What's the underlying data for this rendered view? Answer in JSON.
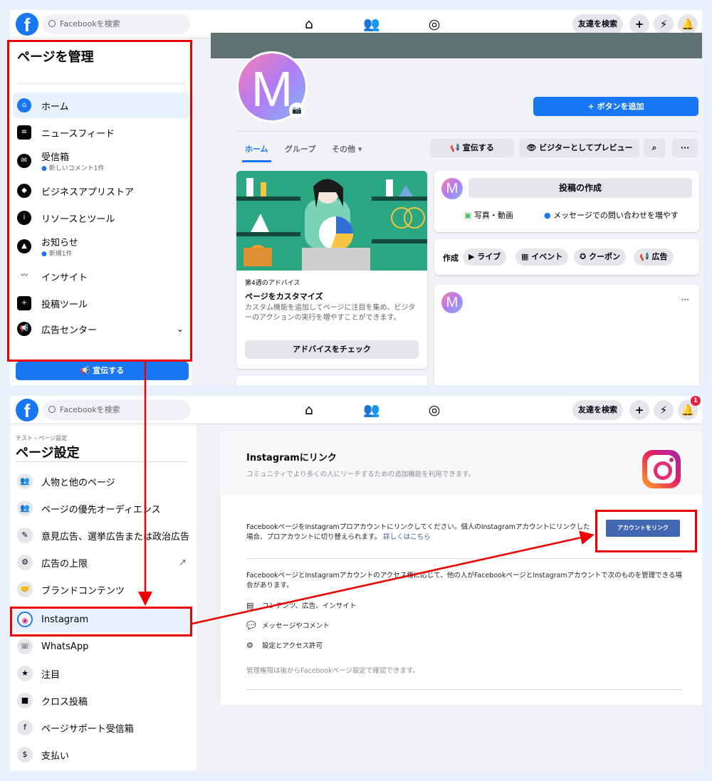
{
  "topbar": {
    "search_placeholder": "Facebookを検索",
    "find_friends": "友達を検索",
    "plus": "+",
    "notif_count": "1"
  },
  "top": {
    "sidebar": {
      "title": "ページを管理",
      "items": [
        {
          "label": "ホーム",
          "sub": ""
        },
        {
          "label": "ニュースフィード",
          "sub": ""
        },
        {
          "label": "受信箱",
          "sub": "新しいコメント1件"
        },
        {
          "label": "ビジネスアプリストア",
          "sub": ""
        },
        {
          "label": "リソースとツール",
          "sub": ""
        },
        {
          "label": "お知らせ",
          "sub": "新規1件"
        },
        {
          "label": "インサイト",
          "sub": ""
        },
        {
          "label": "投稿ツール",
          "sub": ""
        },
        {
          "label": "広告センター",
          "sub": ""
        }
      ],
      "promote": "宣伝する"
    },
    "page": {
      "avatar_letter": "M",
      "add_button": "+ ボタンを追加",
      "tabs": [
        "ホーム",
        "グループ",
        "その他 ▾"
      ],
      "promote": "宣伝する",
      "preview": "ビジターとしてプレビュー"
    },
    "advice": {
      "week": "第4週のアドバイス",
      "title": "ページをカスタマイズ",
      "body": "カスタム機能を追加してページに注目を集め、ビジターのアクションの実行を増やすことができます。",
      "button": "アドバイスをチェック"
    },
    "composer": {
      "create_post": "投稿の作成",
      "photo": "写真・動画",
      "messages": "メッセージでの問い合わせを増やす",
      "create": "作成",
      "live": "ライブ",
      "event": "イベント",
      "coupon": "クーポン",
      "ad": "広告"
    }
  },
  "bottom": {
    "sidebar": {
      "breadcrumb": "テスト › ページ設定",
      "title": "ページ設定",
      "items": [
        "人物と他のページ",
        "ページの優先オーディエンス",
        "意見広告、選挙広告または政治広告",
        "広告の上限",
        "ブランドコンテンツ",
        "Instagram",
        "WhatsApp",
        "注目",
        "クロス投稿",
        "ページサポート受信箱",
        "支払い"
      ]
    },
    "instagram": {
      "title": "Instagramにリンク",
      "subtitle": "コミュニティでより多くの人にリーチするための追加機能を利用できます。",
      "desc": "FacebookページをInstagramプロアカウントにリンクしてください。個人のInstagramアカウントにリンクした場合、プロアカウントに切り替えられます。",
      "learn_more": "詳しくはこちら",
      "link_button": "アカウントをリンク",
      "access_text": "FacebookページとInstagramアカウントのアクセス権に応じて、他の人がFacebookページとInstagramアカウントで次のものを管理できる場合があります。",
      "rows": [
        "コンテンツ、広告、インサイト",
        "メッセージやコメント",
        "設定とアクセス許可"
      ],
      "footer": "管理権限は後からFacebookページ設定で確認できます。"
    }
  },
  "colors": {
    "brand": "#1877f2",
    "highlight": "#e00000",
    "link_button": "#4267b2"
  }
}
